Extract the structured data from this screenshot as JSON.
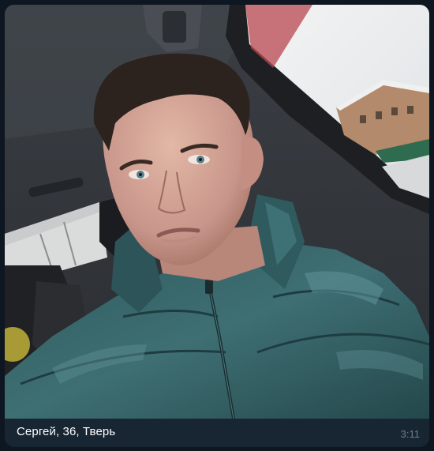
{
  "message": {
    "photo_subject": "selfie-man-in-car",
    "caption": "Сергей, 36, Тверь",
    "time": "3:11"
  },
  "colors": {
    "background": "#0e1621",
    "bubble": "#182533",
    "caption_text": "#ffffff",
    "time_text": "#6d7f8f"
  }
}
